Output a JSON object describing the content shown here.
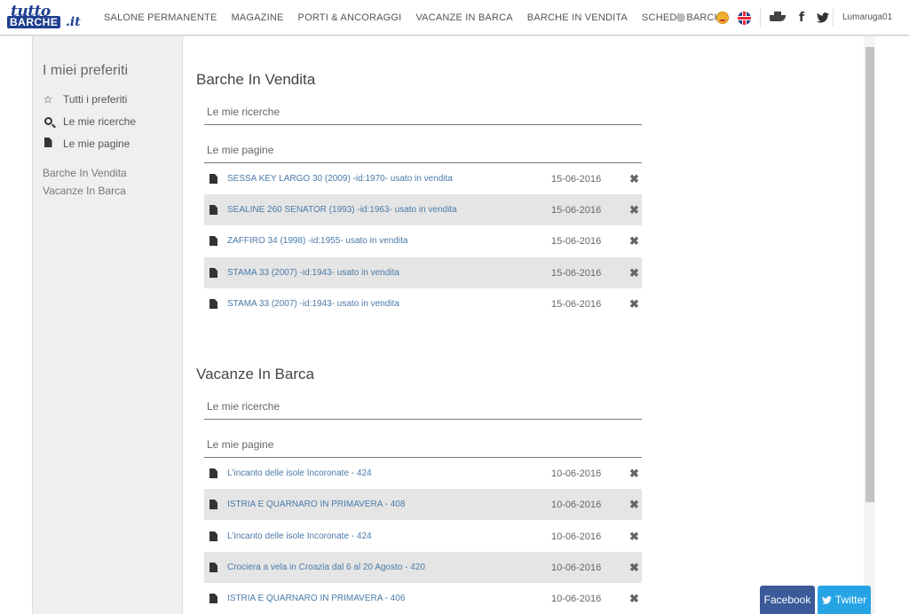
{
  "brand": {
    "logo_top": "tutto",
    "logo_main": "BARCHE",
    "logo_suffix": ".it"
  },
  "nav": {
    "items": [
      "SALONE PERMANENTE",
      "MAGAZINE",
      "PORTI & ANCORAGGI",
      "VACANZE IN BARCA",
      "BARCHE IN VENDITA",
      "SCHEDE BARCHE"
    ]
  },
  "topbar": {
    "username": "Lumaruga01",
    "facebook_glyph": "f",
    "twitter_glyph": "🐦"
  },
  "sidebar": {
    "title": "I miei preferiti",
    "items": [
      {
        "icon": "star-icon",
        "label": "Tutti i preferiti"
      },
      {
        "icon": "search-icon",
        "label": "Le mie ricerche"
      },
      {
        "icon": "document-icon",
        "label": "Le mie pagine"
      }
    ],
    "links": [
      "Barche In Vendita",
      "Vacanze In Barca"
    ]
  },
  "sections": [
    {
      "title": "Barche In Vendita",
      "searches_label": "Le mie ricerche",
      "pages_label": "Le mie pagine",
      "rows": [
        {
          "text": "SESSA KEY LARGO 30 (2009) -id:1970- usato in vendita",
          "date": "15-06-2016"
        },
        {
          "text": "SEALINE 260 SENATOR (1993) -id:1963- usato in vendita",
          "date": "15-06-2016"
        },
        {
          "text": "ZAFFIRO 34 (1998) -id:1955- usato in vendita",
          "date": "15-06-2016"
        },
        {
          "text": "STAMA 33 (2007) -id:1943- usato in vendita",
          "date": "15-06-2016"
        },
        {
          "text": "STAMA 33 (2007) -id:1943- usato in vendita",
          "date": "15-06-2016"
        }
      ]
    },
    {
      "title": "Vacanze In Barca",
      "searches_label": "Le mie ricerche",
      "pages_label": "Le mie pagine",
      "rows": [
        {
          "text": "L'incanto delle isole Incoronate - 424",
          "date": "10-06-2016"
        },
        {
          "text": "ISTRIA E QUARNARO IN PRIMAVERA - 408",
          "date": "10-06-2016"
        },
        {
          "text": "L'incanto delle isole Incoronate - 424",
          "date": "10-06-2016"
        },
        {
          "text": "Crociera a vela in Croazia dal 6 al 20 Agosto - 420",
          "date": "10-06-2016"
        },
        {
          "text": "ISTRIA E QUARNARO IN PRIMAVERA - 406",
          "date": "10-06-2016"
        }
      ]
    }
  ],
  "share": {
    "facebook": "Facebook",
    "twitter": "Twitter"
  },
  "colors": {
    "link": "#4a7aa8",
    "facebook": "#3b5a9a",
    "twitter": "#27a4e6",
    "logo": "#1f3f8f"
  }
}
